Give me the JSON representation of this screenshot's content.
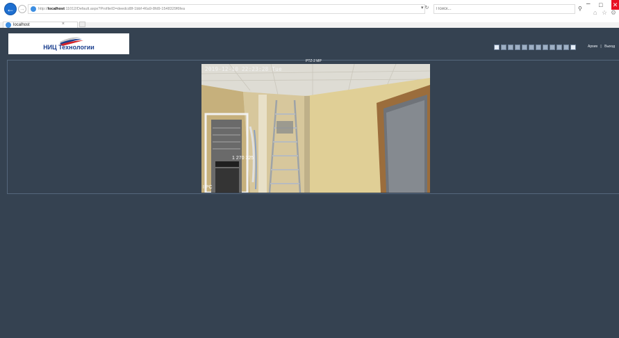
{
  "browser": {
    "address": {
      "prefix": "http://",
      "host": "localhost",
      "rest": ":11012/Default.aspx?ProfileID=deedcd8f-1bbf-46a9-8fd9-1548329f6fea"
    },
    "search_placeholder": "Поиск...",
    "tab_title": "localhost"
  },
  "page": {
    "logo_text": "НИЦ Технологии",
    "top_links": [
      "Архив",
      "|",
      "Выход"
    ],
    "layouts_count_label": "11",
    "camera_name": "PTZ-2 MP",
    "video": {
      "timestamp": "2019-12-10 22:23:28 Tue",
      "center_label": "1 270 325",
      "corner_label": "I PC"
    }
  },
  "colors": {
    "page_bg": "#354251",
    "accent": "#1e6fd0",
    "close": "#e81123"
  }
}
